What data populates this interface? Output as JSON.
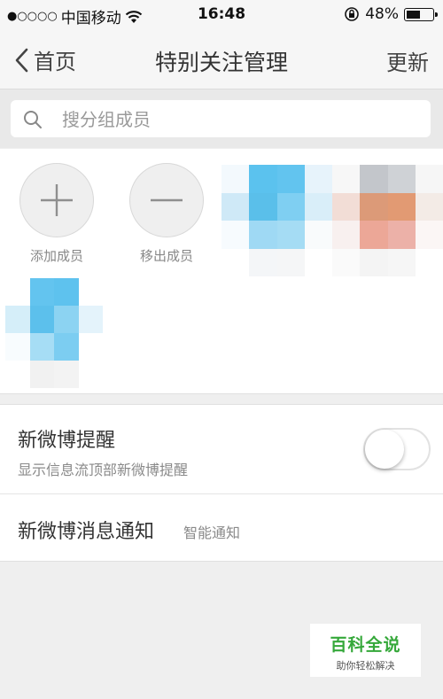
{
  "status_bar": {
    "signal_dots": "●○○○○",
    "carrier": "中国移动",
    "time": "16:48",
    "battery": "48%",
    "battery_level": 0.48
  },
  "nav": {
    "back_label": "首页",
    "title": "特别关注管理",
    "right_label": "更新"
  },
  "search": {
    "placeholder": "搜分组成员"
  },
  "members": {
    "add_label": "添加成员",
    "remove_label": "移出成员"
  },
  "settings": {
    "notify_title": "新微博提醒",
    "notify_subtitle": "显示信息流顶部新微博提醒",
    "notify_enabled": false,
    "message_title": "新微博消息通知",
    "message_value": "智能通知"
  },
  "watermark": {
    "title": "百科全说",
    "subtitle": "助你轻松解决"
  },
  "colors": {
    "watermark_green": "#35a83a",
    "avatar_blue": "#5bc2ee"
  }
}
